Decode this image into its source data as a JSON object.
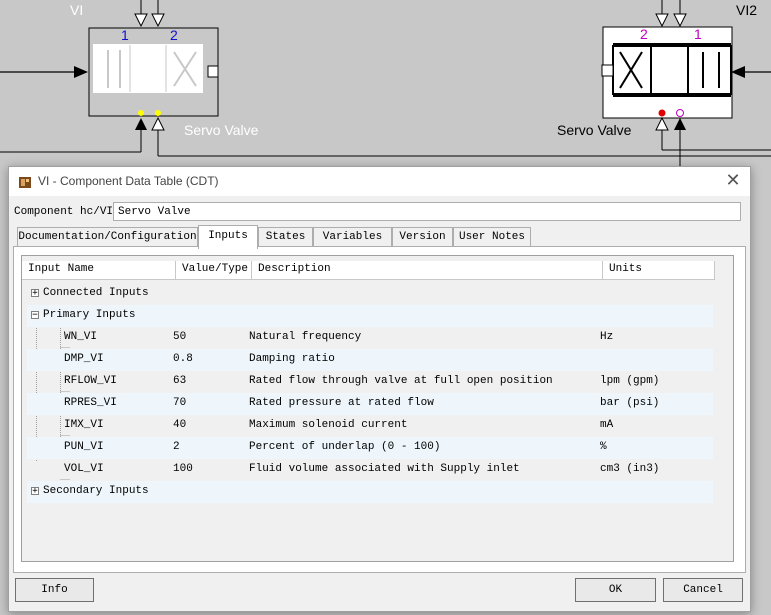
{
  "background": {
    "valve_left": {
      "name": "VI",
      "port1": "1",
      "port2": "2",
      "caption": "Servo Valve"
    },
    "valve_right": {
      "name": "VI2",
      "port1": "1",
      "port2": "2",
      "caption": "Servo Valve"
    }
  },
  "dialog": {
    "title": "VI - Component Data Table (CDT)",
    "close_glyph": "✕",
    "component_label": "Component hc/VI",
    "component_value": "Servo Valve",
    "tabs": [
      {
        "label": "Documentation/Configuration"
      },
      {
        "label": "Inputs"
      },
      {
        "label": "States"
      },
      {
        "label": "Variables"
      },
      {
        "label": "Version"
      },
      {
        "label": "User Notes"
      }
    ],
    "active_tab": "Inputs",
    "table": {
      "columns": [
        "Input Name",
        "Value/Type",
        "Description",
        "Units"
      ],
      "groups": {
        "connected": {
          "expander": "+",
          "label": "Connected Inputs"
        },
        "primary": {
          "expander": "−",
          "label": "Primary Inputs"
        },
        "secondary": {
          "expander": "+",
          "label": "Secondary Inputs"
        }
      },
      "rows": [
        {
          "name": "WN_VI",
          "value": "50",
          "description": "Natural frequency",
          "units": "Hz"
        },
        {
          "name": "DMP_VI",
          "value": "0.8",
          "description": "Damping ratio",
          "units": ""
        },
        {
          "name": "RFLOW_VI",
          "value": "63",
          "description": "Rated flow through valve at full open position",
          "units": "lpm (gpm)"
        },
        {
          "name": "RPRES_VI",
          "value": "70",
          "description": "Rated pressure at rated flow",
          "units": "bar (psi)"
        },
        {
          "name": "IMX_VI",
          "value": "40",
          "description": "Maximum solenoid current",
          "units": "mA"
        },
        {
          "name": "PUN_VI",
          "value": "2",
          "description": "Percent of underlap (0 - 100)",
          "units": "%"
        },
        {
          "name": "VOL_VI",
          "value": "100",
          "description": "Fluid volume associated with Supply inlet",
          "units": "cm3 (in3)"
        }
      ]
    },
    "buttons": {
      "info": "Info",
      "ok": "OK",
      "cancel": "Cancel"
    }
  },
  "colors": {
    "port_blue": "#1010d0",
    "port_magenta": "#c000c0",
    "port_red": "#e00000",
    "port_yellow": "#ffff00"
  }
}
